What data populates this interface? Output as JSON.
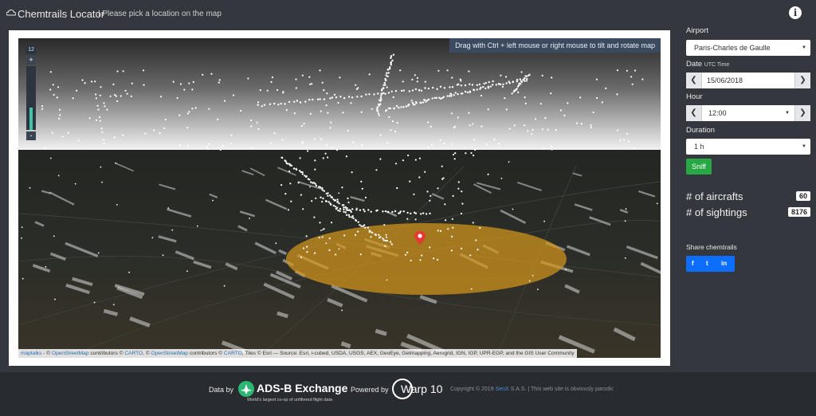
{
  "header": {
    "logo_icon": "cloud-icon",
    "title": "Chemtrails Locator",
    "subtitle": "| Please pick a location on the map",
    "info_icon": "info-circle-icon",
    "info_glyph": "i"
  },
  "map": {
    "tilt_hint": "Drag with Ctrl + left mouse or right mouse to tilt and rotate map",
    "zoom_level": "12",
    "zoom_in": "+",
    "zoom_out": "-",
    "zoom_fill_fraction": 0.35,
    "marker_icon": "map-pin-icon",
    "marker_color": "#e53935",
    "sniff_area_color": "#d4951c",
    "attribution": {
      "maptalks": "maptalks",
      "sep1": " - © ",
      "osm1": "OpenStreetMap",
      "contrib1": " contributors © ",
      "carto1": "CARTO",
      "sep2": ", © ",
      "osm2": "OpenStreetMap",
      "contrib2": " contributors © ",
      "carto2": "CARTO",
      "tiles": ", Tiles © Esri — Source: Esri, i-cubed, USDA, USGS, AEX, GeoEye, Getmapping, Aerogrid, IGN, IGP, UPR-EGP, and the GIS User Community"
    }
  },
  "panel": {
    "airport_label": "Airport",
    "airport_value": "Paris-Charles de Gaulle",
    "date_label": "Date",
    "date_sub": "UTC Time",
    "date_value": "15/06/2018",
    "hour_label": "Hour",
    "hour_value": "12:00",
    "duration_label": "Duration",
    "duration_value": "1 h",
    "prev_glyph": "❮",
    "next_glyph": "❯",
    "caret_glyph": "▼",
    "sniff_label": "Sniff",
    "aircrafts_label": "# of aircrafts",
    "aircrafts_value": "60",
    "sightings_label": "# of sightings",
    "sightings_value": "8176",
    "share_label": "Share chemtrails",
    "share_icons": [
      "facebook-icon",
      "twitter-icon",
      "linkedin-icon"
    ],
    "share_glyphs": [
      "f",
      "t",
      "in"
    ],
    "accent_green": "#28a745",
    "accent_blue": "#0d6efd"
  },
  "footer": {
    "data_by": "Data by",
    "adsb_name": "ADS-B Exchange",
    "adsb_tagline": "World's largest co-op of unfiltered flight data",
    "powered_by": "Powered by",
    "warp_name": "Warp 10",
    "copyright_pre": "Copyright © 2019 ",
    "copyright_link": "SenX",
    "copyright_post": " S.A.S. | This web site is obviously parodic"
  }
}
